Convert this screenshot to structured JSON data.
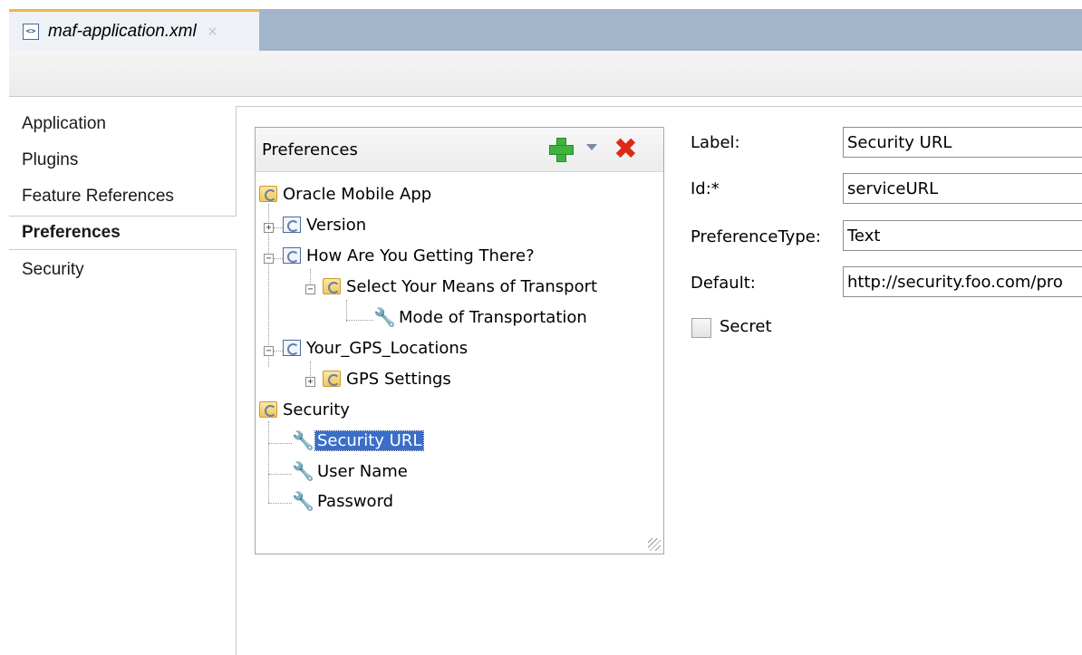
{
  "editor_tab": {
    "title": "maf-application.xml",
    "close_glyph": "×",
    "icon": "xml-file-icon"
  },
  "nav": {
    "items": [
      {
        "label": "Application"
      },
      {
        "label": "Plugins"
      },
      {
        "label": "Feature References"
      },
      {
        "label": "Preferences",
        "selected": true
      },
      {
        "label": "Security"
      }
    ]
  },
  "preferences_panel": {
    "title": "Preferences",
    "add_icon": "add-icon",
    "dropdown_icon": "chevron-down-icon",
    "delete_icon": "delete-icon",
    "delete_glyph": "✖",
    "tree": [
      {
        "label": "Oracle Mobile App",
        "icon": "preference-group-folder-icon"
      },
      {
        "label": "Version",
        "icon": "preference-page-icon",
        "expander": "+"
      },
      {
        "label": "How Are You Getting There?",
        "icon": "preference-page-icon",
        "expander": "−"
      },
      {
        "label": "Select Your Means of Transport",
        "icon": "preference-group-folder-icon",
        "expander": "−"
      },
      {
        "label": "Mode of Transportation",
        "icon": "wrench-icon"
      },
      {
        "label": "Your_GPS_Locations",
        "icon": "preference-page-icon",
        "expander": "−"
      },
      {
        "label": "GPS Settings",
        "icon": "preference-group-folder-icon",
        "expander": "+"
      },
      {
        "label": "Security",
        "icon": "preference-group-folder-icon"
      },
      {
        "label": "Security URL",
        "icon": "wrench-icon",
        "selected": true
      },
      {
        "label": "User Name",
        "icon": "wrench-icon"
      },
      {
        "label": "Password",
        "icon": "wrench-icon"
      }
    ]
  },
  "properties": {
    "label_caption": "Label:",
    "label_value": "Security URL",
    "id_caption": "Id:*",
    "id_value": "serviceURL",
    "type_caption": "PreferenceType:",
    "type_value": "Text",
    "default_caption": "Default:",
    "default_value": "http://security.foo.com/pro",
    "secret_label": "Secret",
    "secret_checked": false
  },
  "colors": {
    "tab_strip": "#a3b5cb",
    "active_tab_accent": "#f4b44a",
    "selection": "#3a6ec8",
    "add_green": "#3cb43c",
    "delete_red": "#dd2a16"
  }
}
